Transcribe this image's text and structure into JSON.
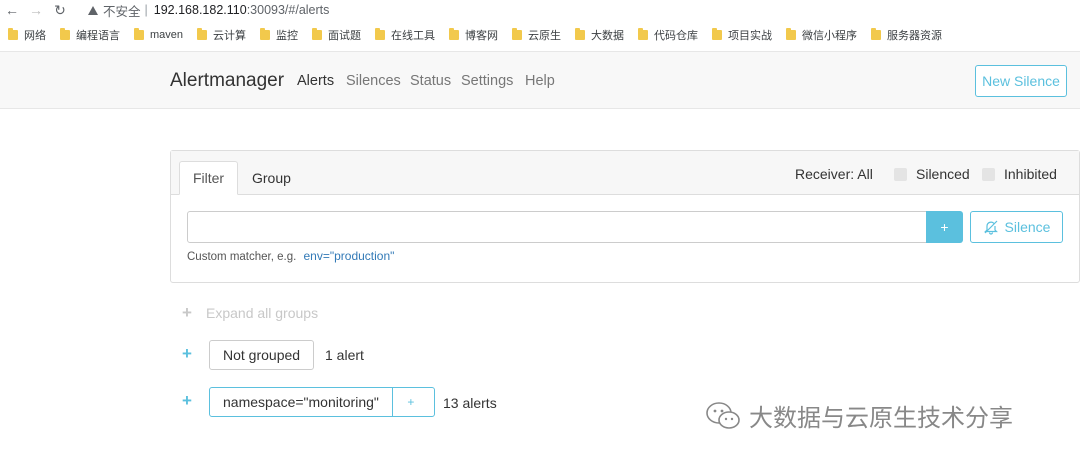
{
  "browser": {
    "security_label": "不安全",
    "url_host": "192.168.182.110",
    "url_path": ":30093/#/alerts"
  },
  "bookmarks": [
    "网络",
    "编程语言",
    "maven",
    "云计算",
    "监控",
    "面试题",
    "在线工具",
    "博客网",
    "云原生",
    "大数据",
    "代码仓库",
    "项目实战",
    "微信小程序",
    "服务器资源"
  ],
  "navbar": {
    "brand": "Alertmanager",
    "links": [
      "Alerts",
      "Silences",
      "Status",
      "Settings",
      "Help"
    ],
    "active": "Alerts",
    "new_silence": "New Silence"
  },
  "filter": {
    "tabs": [
      "Filter",
      "Group"
    ],
    "receiver": "Receiver: All",
    "silenced_label": "Silenced",
    "inhibited_label": "Inhibited",
    "input_value": "",
    "add_label": "+",
    "silence_label": "Silence",
    "hint": "Custom matcher, e.g.",
    "hint_example": "env=\"production\""
  },
  "groups": {
    "expand_all": "Expand all groups",
    "items": [
      {
        "label": "Not grouped",
        "count": "1 alert"
      },
      {
        "label": "namespace=\"monitoring\"",
        "add_label": "+",
        "count": "13 alerts"
      }
    ]
  },
  "watermark": "大数据与云原生技术分享",
  "colors": {
    "accent": "#5bc0de",
    "link": "#337ab7",
    "navbar_bg": "#f8f8f8"
  }
}
